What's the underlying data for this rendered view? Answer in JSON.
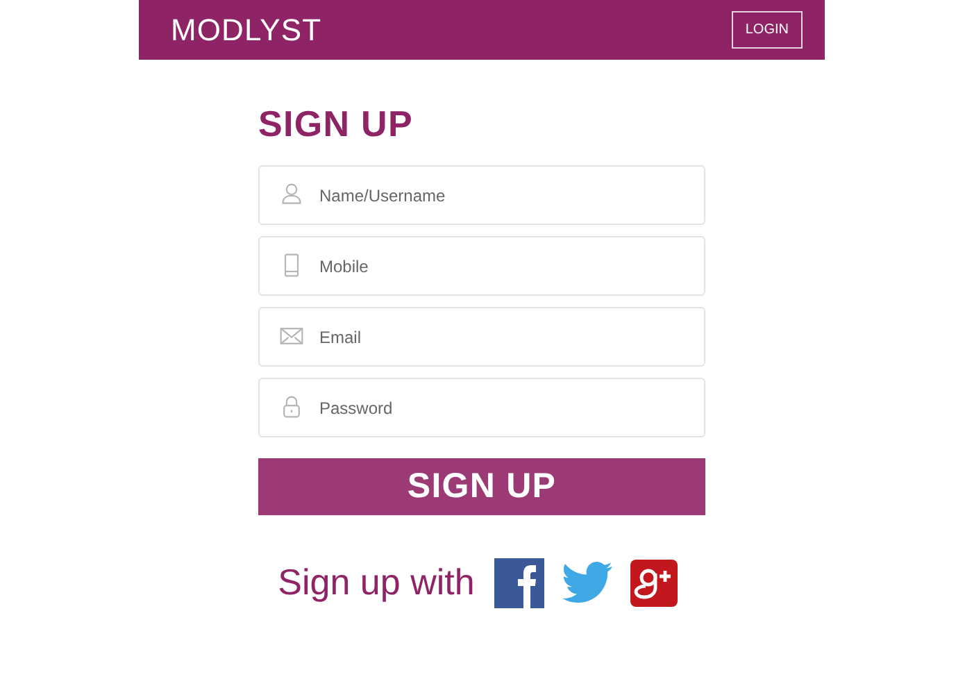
{
  "header": {
    "brand": "MODLYST",
    "login_button": "LOGIN"
  },
  "heading": "SIGN UP",
  "fields": [
    {
      "kind": "user",
      "placeholder": "Name/Username"
    },
    {
      "kind": "phone",
      "placeholder": "Mobile"
    },
    {
      "kind": "email",
      "placeholder": "Email"
    },
    {
      "kind": "lock",
      "placeholder": "Password"
    }
  ],
  "submit_button": "SIGN UP",
  "social": {
    "label": "Sign up with",
    "networks": [
      {
        "kind": "facebook"
      },
      {
        "kind": "twitter"
      },
      {
        "kind": "googleplus"
      }
    ]
  }
}
